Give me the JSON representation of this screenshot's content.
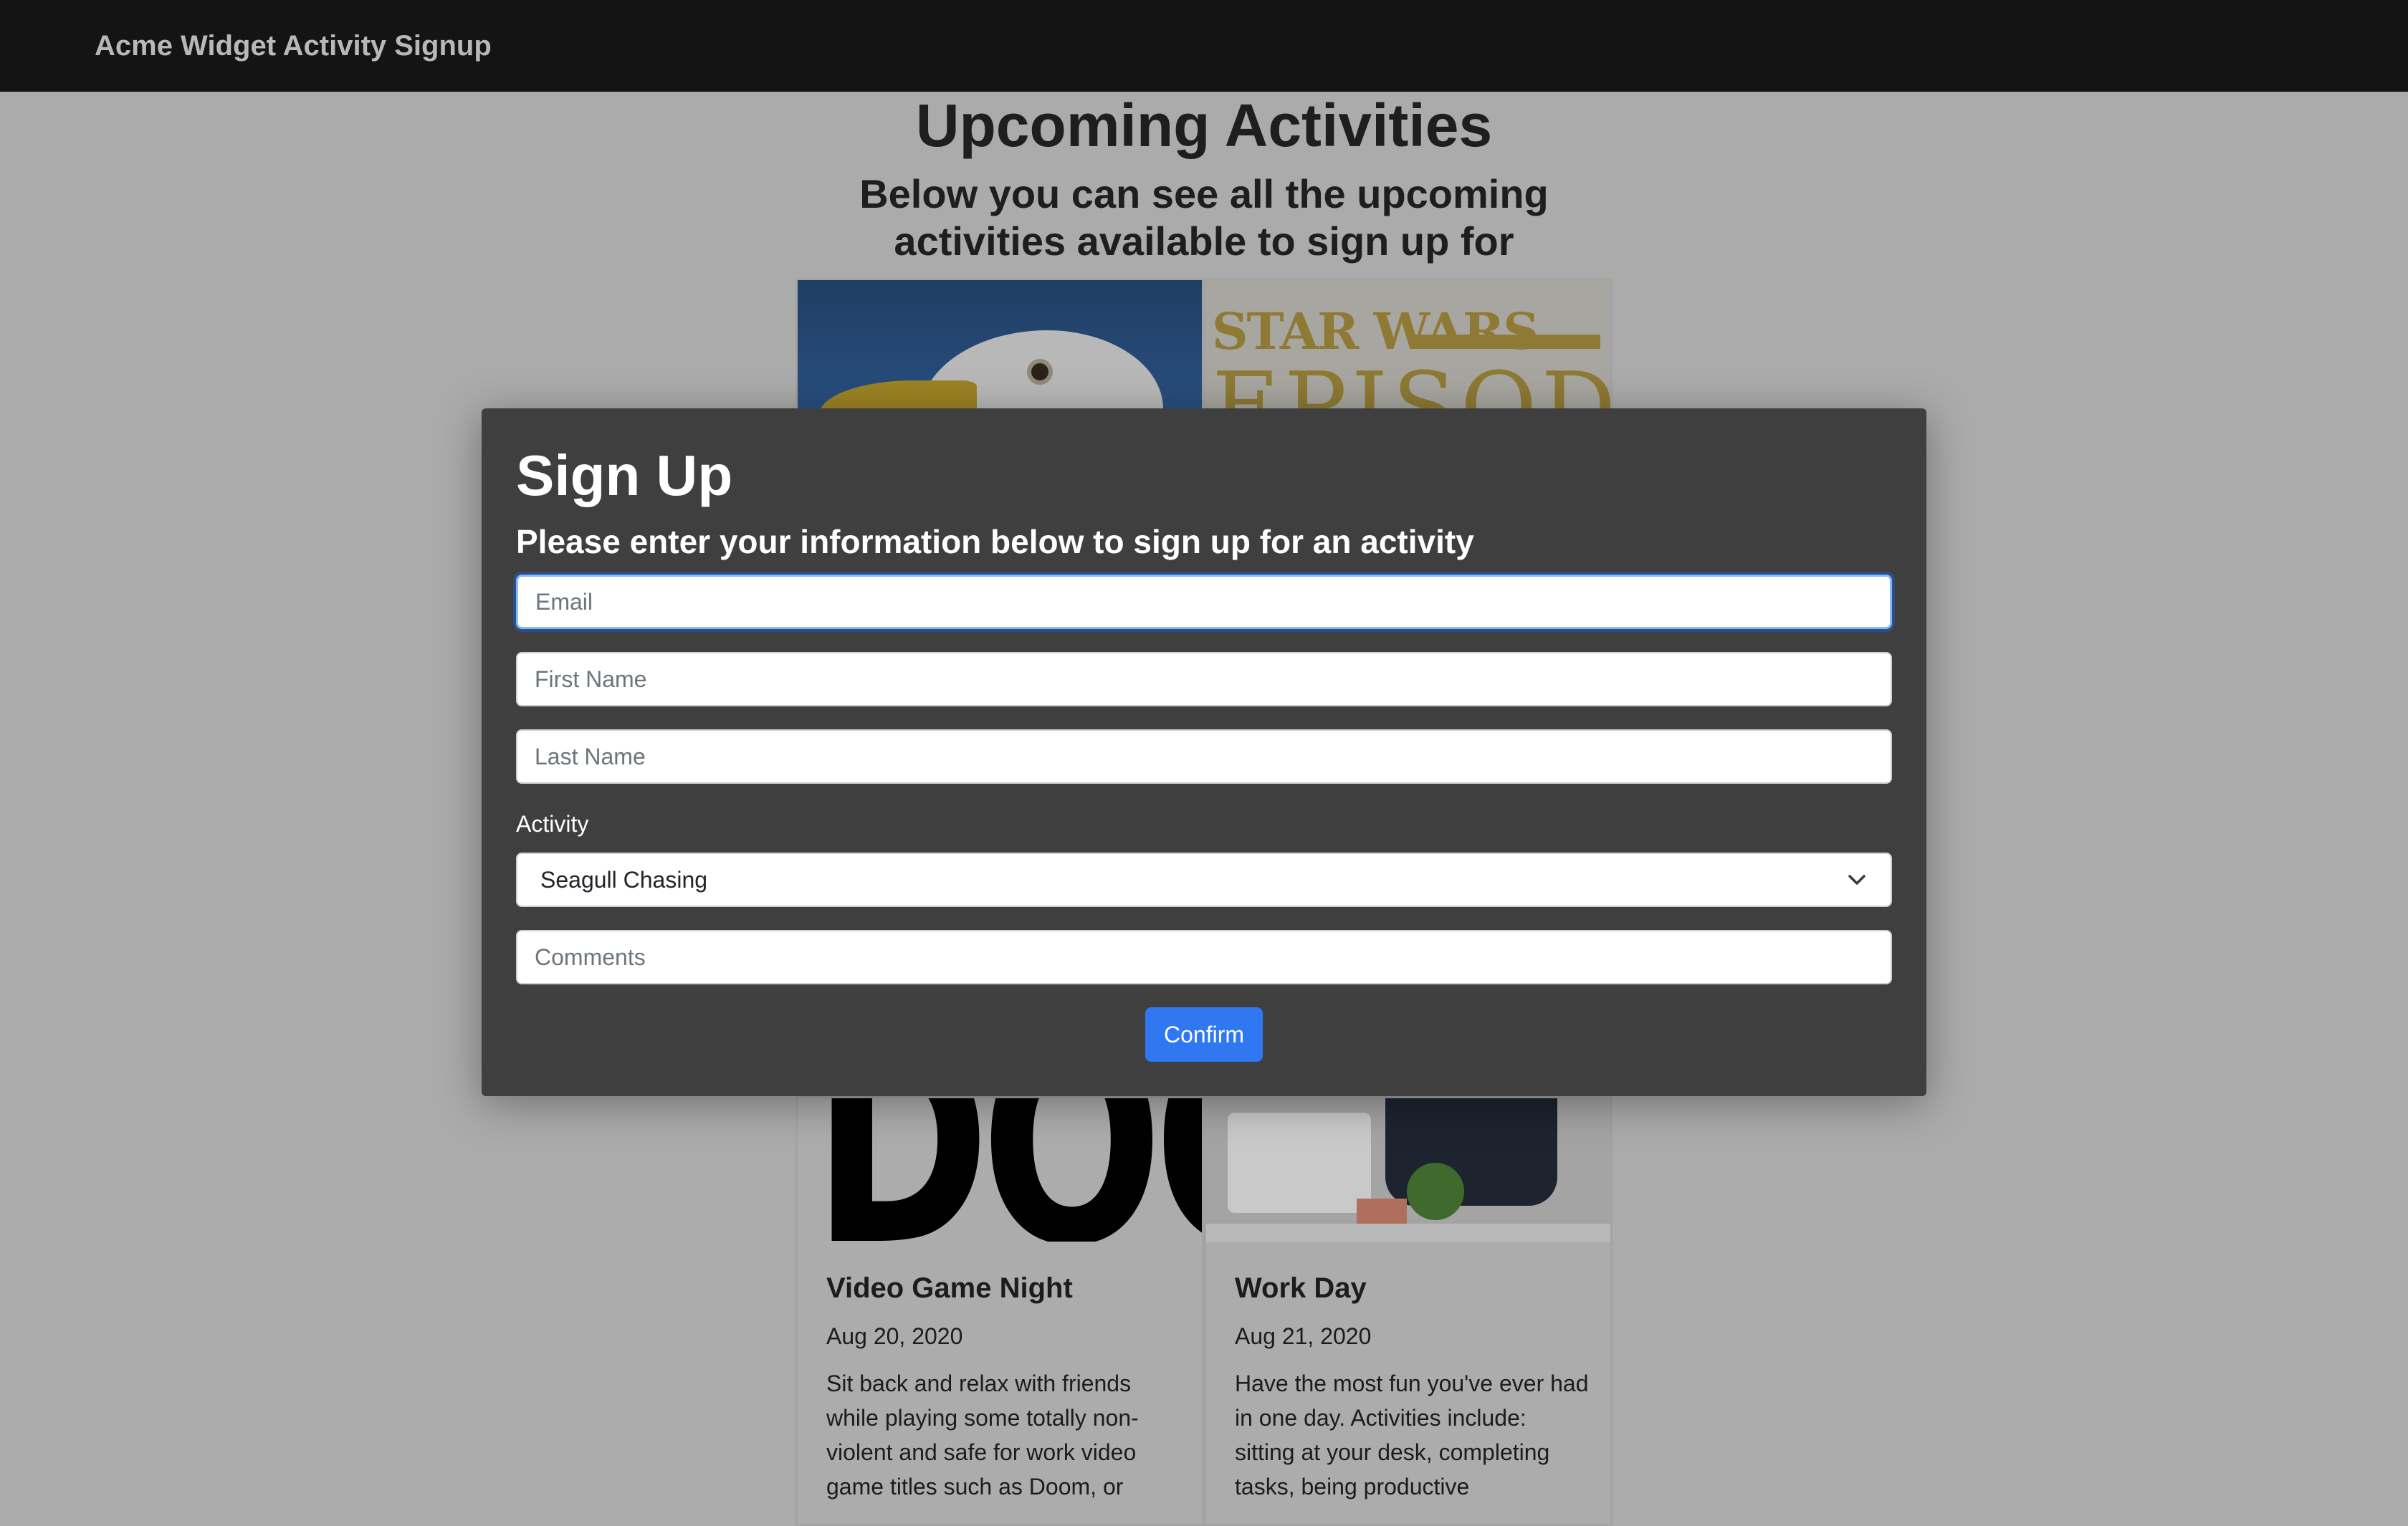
{
  "navbar": {
    "brand": "Acme Widget Activity Signup"
  },
  "page": {
    "title": "Upcoming Activities",
    "subtitle": "Below you can see all the upcoming activities available to sign up for"
  },
  "cards": [
    {
      "title": "Video Game Night",
      "date": "Aug 20, 2020",
      "text": "Sit back and relax with friends while playing some totally non-violent and safe for work video game titles such as Doom, or"
    },
    {
      "title": "Work Day",
      "date": "Aug 21, 2020",
      "text": "Have the most fun you've ever had in one day. Activities include: sitting at your desk, completing tasks, being productive"
    }
  ],
  "images": {
    "starwars_logo": "STAR WARS",
    "starwars_episode": "EPISODE I",
    "doom_logo": "DOOM"
  },
  "modal": {
    "title": "Sign Up",
    "subtitle": "Please enter your information below to sign up for an activity",
    "email_placeholder": "Email",
    "first_name_placeholder": "First Name",
    "last_name_placeholder": "Last Name",
    "activity_label": "Activity",
    "activity_selected": "Seagull Chasing",
    "comments_placeholder": "Comments",
    "confirm_label": "Confirm"
  },
  "colors": {
    "primary": "#2f78f2",
    "navbar": "#141414",
    "modal": "#3f3f3f"
  }
}
